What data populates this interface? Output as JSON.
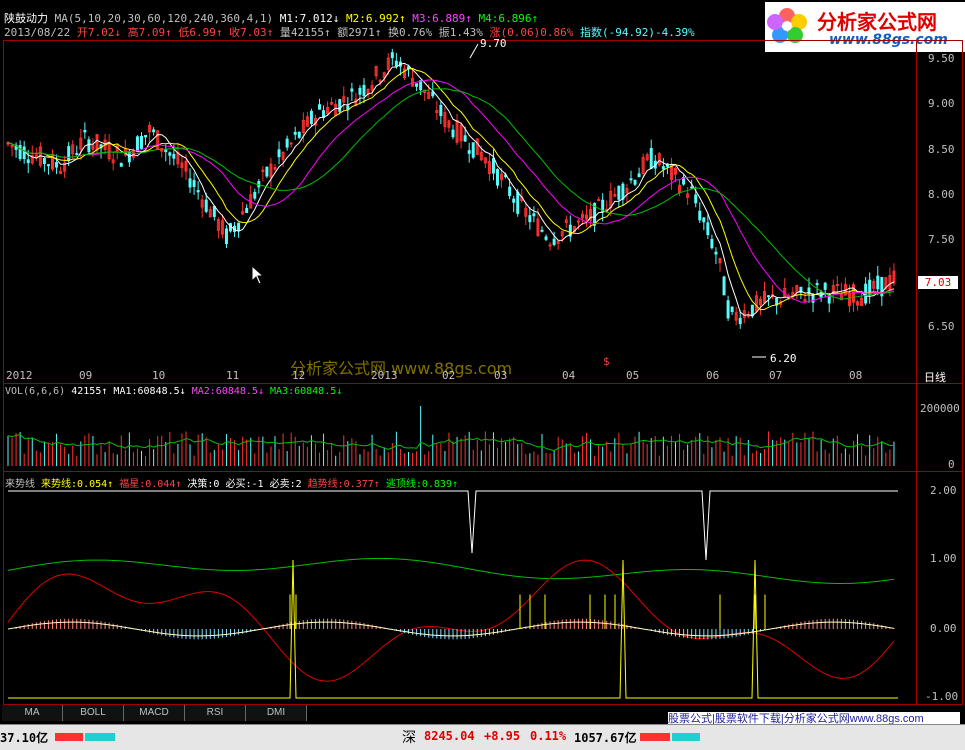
{
  "header": {
    "stock_name": "陕鼓动力",
    "ma_params": "MA(5,10,20,30,60,120,240,360,4,1)",
    "m1": "M1:7.012",
    "m2": "M2:6.992",
    "m3": "M3:6.889",
    "m4": "M4:6.896",
    "date": "2013/08/22",
    "open": "开7.02",
    "high": "高7.09",
    "low": "低6.99",
    "close": "收7.03",
    "volume": "量42155",
    "amount": "额2971",
    "turnover": "换0.76%",
    "amplitude": "振1.43%",
    "change": "涨(0.06)0.86%",
    "index": "指数(-94.92)-4.39%"
  },
  "logo": {
    "text": "分析家公式网",
    "url": "www.88gs.com"
  },
  "price_panel": {
    "high_marker": "9.70",
    "low_marker": "6.20",
    "current_price": "7.03",
    "y_ticks": [
      "9.50",
      "9.00",
      "8.50",
      "8.00",
      "7.50",
      "7.00",
      "6.50"
    ],
    "watermark": "分析家公式网 www.88gs.com",
    "x_labels": [
      "2012",
      "09",
      "10",
      "11",
      "12",
      "2013",
      "02",
      "03",
      "04",
      "05",
      "06",
      "07",
      "08"
    ],
    "period": "日线"
  },
  "vol_panel": {
    "label": "VOL(6,6,6)",
    "vol": "42155",
    "ma1": "MA1:60848.5",
    "ma2": "MA2:60848.5",
    "ma3": "MA3:60848.5",
    "y_ticks": [
      "200000",
      "0"
    ]
  },
  "indicator_panel": {
    "name": "来势线",
    "lsx": "来势线:0.054",
    "fx": "福星:0.044",
    "jc": "决策:0",
    "bm": "必买:-1",
    "bs": "必卖:2",
    "qsx": "趋势线:0.377",
    "tdx": "逃顶线:0.839",
    "y_ticks": [
      "2.00",
      "1.00",
      "0.00",
      "-1.00"
    ]
  },
  "tabs": [
    "MA",
    "BOLL",
    "MACD",
    "RSI",
    "DMI"
  ],
  "status": {
    "left_amount": "37.10亿",
    "market": "深",
    "index_value": "8245.04",
    "index_change": "+8.95",
    "index_pct": "0.11%",
    "turnover": "1057.67亿"
  },
  "ad_text": "股票公式|股票软件下载|分析家公式网www.88gs.com",
  "colors": {
    "up": "#ff3030",
    "down": "#54fcfc",
    "ma_white": "#ffffff",
    "ma_yellow": "#ffff00",
    "ma_magenta": "#ff00ff",
    "ma_green": "#00c000",
    "border": "#a00000"
  }
}
